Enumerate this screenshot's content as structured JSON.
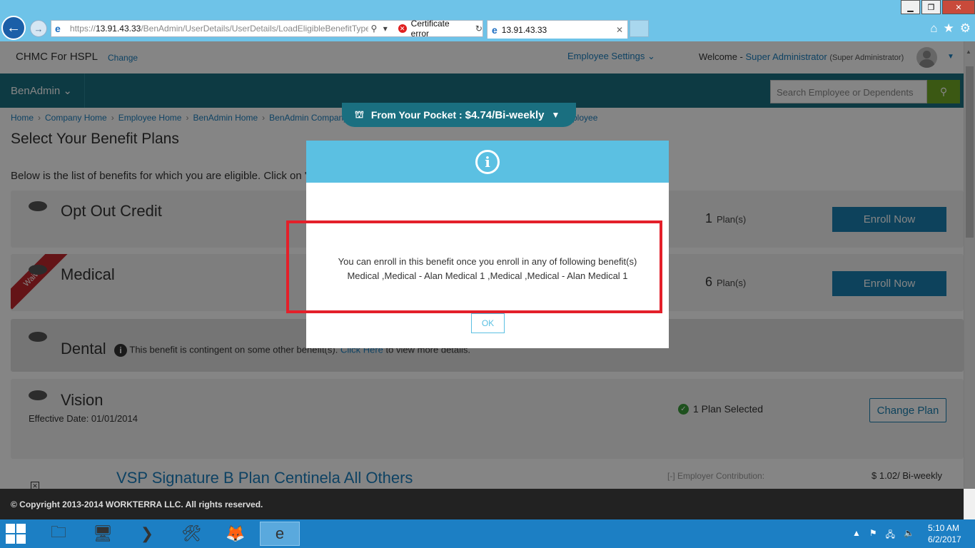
{
  "browser": {
    "url_prefix": "https://",
    "url_host": "13.91.43.33",
    "url_path": "/BenAdmin/UserDetails/UserDetails/LoadEligibleBenefitTypes",
    "cert_error": "Certificate error",
    "tab_title": "13.91.43.33"
  },
  "header": {
    "brand": "CHMC For HSPL",
    "change_link": "Change",
    "employee_settings": "Employee Settings",
    "welcome_label": "Welcome -",
    "user_name": "Super Administrator",
    "user_role": "(Super Administrator)"
  },
  "nav": {
    "module": "BenAdmin",
    "search_placeholder": "Search Employee or Dependents"
  },
  "breadcrumb": {
    "items": [
      "Home",
      "Company Home",
      "Employee Home",
      "BenAdmin Home",
      "BenAdmin Company H"
    ],
    "tail": "ployee"
  },
  "pocket": {
    "label": "From Your Pocket :",
    "value": "$4.74/Bi-weekly"
  },
  "page": {
    "title": "Select Your Benefit Plans",
    "intro": "Below is the list of benefits for which you are eligible. Click on \"E"
  },
  "benefits": [
    {
      "name": "Opt Out Credit",
      "count": "1",
      "count_label": "Plan(s)",
      "action": "Enroll Now"
    },
    {
      "name": "Medical",
      "badge": "Waived",
      "count": "6",
      "count_label": "Plan(s)",
      "action": "Enroll Now"
    },
    {
      "name": "Dental",
      "note_before": "This benefit is contingent on some other benefit(s).",
      "note_link": "Click Here",
      "note_after": "to view more details."
    },
    {
      "name": "Vision",
      "effective": "Effective Date: 01/01/2014",
      "status": "1 Plan Selected",
      "action": "Change Plan"
    }
  ],
  "plan_row": {
    "name": "VSP Signature B Plan Centinela All Others",
    "employer_label": "[-] Employer Contribution:",
    "employer_value": "$ 1.02/ Bi-weekly"
  },
  "footer": {
    "copyright": "© Copyright 2013-2014 WORKTERRA LLC. All rights reserved."
  },
  "modal": {
    "message_line1": "You can enroll in this benefit once you enroll in any of following benefit(s)",
    "message_line2": "Medical ,Medical - Alan Medical 1 ,Medical ,Medical - Alan Medical 1",
    "ok_label": "OK",
    "accent": "#5bc0e2"
  },
  "taskbar": {
    "time": "5:10 AM",
    "date": "6/2/2017"
  },
  "colors": {
    "nav": "#1a6f80",
    "primary_button": "#1a7fb0",
    "search_button": "#72a925",
    "highlight": "#e3202a"
  }
}
